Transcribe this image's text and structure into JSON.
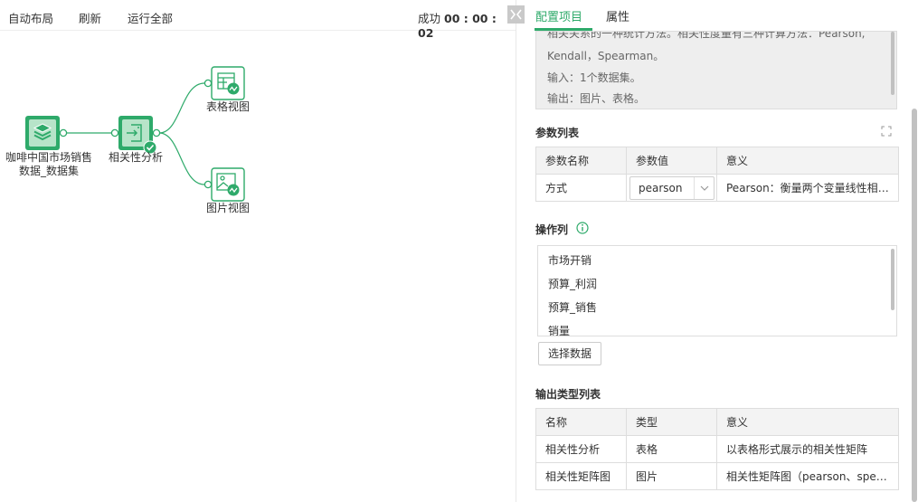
{
  "toolbar": {
    "auto_layout": "自动布局",
    "refresh": "刷新",
    "run_all": "运行全部",
    "status_label": "成功",
    "status_time": "00 : 00 : 02"
  },
  "flow": {
    "nodes": {
      "dataset": {
        "label_line1": "咖啡中国市场销售",
        "label_line2": "数据_数据集",
        "icon": "layers-icon"
      },
      "correlation": {
        "label": "相关性分析",
        "icon": "transform-icon",
        "status": "success"
      },
      "table_view": {
        "label": "表格视图",
        "icon": "table-chart-icon"
      },
      "image_view": {
        "label": "图片视图",
        "icon": "image-chart-icon"
      }
    },
    "accent": "#2eaa6a",
    "node_fill": "#c8ead7"
  },
  "tabs": {
    "config": "配置项目",
    "properties": "属性"
  },
  "description": {
    "line1": "相关关系的一种统计方法。相关性度量有三种计算方法：Pearson,",
    "line2": "Kendall，Spearman。",
    "line3": "输入：1个数据集。",
    "line4": "输出：图片、表格。"
  },
  "params": {
    "title": "参数列表",
    "headers": [
      "参数名称",
      "参数值",
      "意义"
    ],
    "rows": [
      {
        "name": "方式",
        "value": "pearson",
        "meaning": "Pearson：衡量两个变量线性相关..."
      }
    ]
  },
  "columns": {
    "title": "操作列",
    "items": [
      "市场开销",
      "预算_利润",
      "预算_销售",
      "销量"
    ],
    "select_button": "选择数据"
  },
  "outputs": {
    "title": "输出类型列表",
    "headers": [
      "名称",
      "类型",
      "意义"
    ],
    "rows": [
      {
        "name": "相关性分析",
        "type": "表格",
        "meaning": "以表格形式展示的相关性矩阵"
      },
      {
        "name": "相关性矩阵图",
        "type": "图片",
        "meaning": "相关性矩阵图（pearson、spearm..."
      }
    ]
  }
}
